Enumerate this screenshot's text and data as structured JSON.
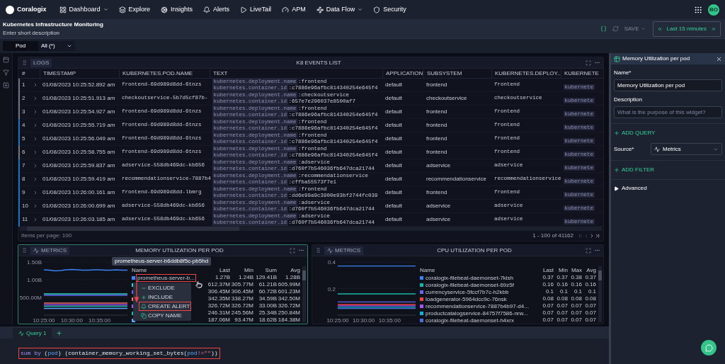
{
  "nav": {
    "brand": "Coralogix",
    "items": [
      {
        "label": "Dashboard",
        "kind": "dashboard",
        "caret": true
      },
      {
        "label": "Explore",
        "kind": "explore",
        "caret": false
      },
      {
        "label": "Insights",
        "kind": "insights",
        "caret": false
      },
      {
        "label": "Alerts",
        "kind": "alerts",
        "caret": false
      },
      {
        "label": "LiveTail",
        "kind": "livetail",
        "caret": false
      },
      {
        "label": "APM",
        "kind": "apm",
        "caret": false
      },
      {
        "label": "Data Flow",
        "kind": "dataflow",
        "caret": true
      },
      {
        "label": "Security",
        "kind": "security",
        "caret": false
      }
    ],
    "avatar": "BO"
  },
  "header": {
    "title": "Kubernetes Infrastructure Monitoring",
    "description": "Enter short description",
    "save": {
      "label": "SAVE",
      "disabled": true
    },
    "time_range": "Last 15 minutes"
  },
  "filter": {
    "label": "Pod",
    "value": "All (*)"
  },
  "logs_widget": {
    "chip": "LOGS",
    "title": "K8 EVENTS LIST",
    "columns": [
      "#",
      "TIMESTAMP",
      "KUBERNETES.POD.NAME",
      "TEXT",
      "APPLICATION",
      "SUBSYSTEM",
      "KUBERNETES.DEPLOY...",
      "KUBERNETE"
    ],
    "rows": [
      {
        "n": "1",
        "timestamp": "01/08/2023 10:25:52.892 am",
        "pod": "frontend-69d989d8dd-6tnzs",
        "text": [
          {
            "kind": "key",
            "text": "kubernetes.deployment.name"
          },
          {
            "kind": "value",
            "text": ":frontend"
          },
          {
            "kind": "key",
            "text": "kubernetes.container.id"
          },
          {
            "kind": "value",
            "text": ":c7886e96afbc814340254e645f4"
          }
        ],
        "application": "default",
        "subsystem": "frontend",
        "deployment": "frontend",
        "column_9": "kubernete",
        "color": "#6b7280"
      },
      {
        "n": "2",
        "timestamp": "01/08/2023 10:25:51.913 am",
        "pod": "checkoutservice-5b7d5cf87b-",
        "text": [
          {
            "kind": "key",
            "text": "kubernetes.deployment.name"
          },
          {
            "kind": "value",
            "text": ":checkoutservice"
          },
          {
            "kind": "key",
            "text": "kubernetes.container.id"
          },
          {
            "kind": "value",
            "text": ":657e7e296037e8500af7"
          }
        ],
        "application": "default",
        "subsystem": "checkoutservice",
        "deployment": "checkoutservice",
        "column_9": "kubernete",
        "color": "#6b7280"
      },
      {
        "n": "3",
        "timestamp": "01/08/2023 10:25:54.927 am",
        "pod": "frontend-69d989d8dd-6tnzs",
        "text": [
          {
            "kind": "key",
            "text": "kubernetes.deployment.name"
          },
          {
            "kind": "value",
            "text": ":frontend"
          },
          {
            "kind": "key",
            "text": "kubernetes.container.id"
          },
          {
            "kind": "value",
            "text": ":c7886e96afbc814340254e645f4"
          }
        ],
        "application": "default",
        "subsystem": "frontend",
        "deployment": "frontend",
        "column_9": "kubernete",
        "color": "#6b7280"
      },
      {
        "n": "4",
        "timestamp": "01/08/2023 10:25:55.719 am",
        "pod": "frontend-69d989d8dd-6tnzs",
        "text": [
          {
            "kind": "key",
            "text": "kubernetes.deployment.name"
          },
          {
            "kind": "value",
            "text": ":frontend"
          },
          {
            "kind": "key",
            "text": "kubernetes.container.id"
          },
          {
            "kind": "value",
            "text": ":c7886e96afbc814340254e645f4"
          }
        ],
        "application": "default",
        "subsystem": "frontend",
        "deployment": "frontend",
        "column_9": "kubernete",
        "color": "#1d6fb8"
      },
      {
        "n": "5",
        "timestamp": "01/08/2023 10:25:56.049 am",
        "pod": "frontend-69d989d8dd-6tnzs",
        "text": [
          {
            "kind": "key",
            "text": "kubernetes.deployment.name"
          },
          {
            "kind": "value",
            "text": ":frontend"
          },
          {
            "kind": "key",
            "text": "kubernetes.container.id"
          },
          {
            "kind": "value",
            "text": ":c7886e96afbc814340254e645f4"
          }
        ],
        "application": "default",
        "subsystem": "frontend",
        "deployment": "frontend",
        "column_9": "kubernete",
        "color": "#1d6fb8"
      },
      {
        "n": "6",
        "timestamp": "01/08/2023 10:25:58.755 am",
        "pod": "frontend-69d989d8dd-6tnzs",
        "text": [
          {
            "kind": "key",
            "text": "kubernetes.deployment.name"
          },
          {
            "kind": "value",
            "text": ":frontend"
          },
          {
            "kind": "key",
            "text": "kubernetes.container.id"
          },
          {
            "kind": "value",
            "text": ":c7886e96afbc814340254e645f4"
          }
        ],
        "application": "default",
        "subsystem": "frontend",
        "deployment": "frontend",
        "column_9": "kubernete",
        "color": "#6b7280"
      },
      {
        "n": "7",
        "timestamp": "01/08/2023 10:25:59.837 am",
        "pod": "adservice-558db469dc-kb656",
        "text": [
          {
            "kind": "key",
            "text": "kubernetes.deployment.name"
          },
          {
            "kind": "value",
            "text": ":adservice"
          },
          {
            "kind": "key",
            "text": "kubernetes.container.id"
          },
          {
            "kind": "value",
            "text": ":d760f7b546036fb647dca21744"
          }
        ],
        "application": "default",
        "subsystem": "adservice",
        "deployment": "adservice",
        "column_9": "kubernete",
        "color": "#1d6fb8"
      },
      {
        "n": "8",
        "timestamp": "01/08/2023 10:25:59.419 am",
        "pod": "recommendationservice-7887b4",
        "text": [
          {
            "kind": "key",
            "text": "kubernetes.deployment.name"
          },
          {
            "kind": "value",
            "text": ":recommendationservice"
          },
          {
            "kind": "key",
            "text": "kubernetes.container.id"
          },
          {
            "kind": "value",
            "text": ":cffba55573f7e1"
          }
        ],
        "application": "default",
        "subsystem": "recommendationservice",
        "deployment": "recommendationservice",
        "column_9": "kubernete",
        "color": "#1d6fb8"
      },
      {
        "n": "9",
        "timestamp": "01/08/2023 10:26:00.161 am",
        "pod": "frontend-69d989d8dd-lbmrg",
        "text": [
          {
            "kind": "key",
            "text": "kubernetes.deployment.name"
          },
          {
            "kind": "value",
            "text": ":frontend"
          },
          {
            "kind": "key",
            "text": "kubernetes.container.id"
          },
          {
            "kind": "value",
            "text": ":dd6e99a9c3900e93bf2744fc039"
          }
        ],
        "application": "default",
        "subsystem": "frontend",
        "deployment": "frontend",
        "column_9": "kubernete",
        "color": "#1d6fb8"
      },
      {
        "n": "10",
        "timestamp": "01/08/2023 10:26:00.699 am",
        "pod": "adservice-558db469dc-kb656",
        "text": [
          {
            "kind": "key",
            "text": "kubernetes.deployment.name"
          },
          {
            "kind": "value",
            "text": ":adservice"
          },
          {
            "kind": "key",
            "text": "kubernetes.container.id"
          },
          {
            "kind": "value",
            "text": ":d760f7b546036fb647dca21744"
          }
        ],
        "application": "default",
        "subsystem": "adservice",
        "deployment": "adservice",
        "column_9": "kubernete",
        "color": "#1d6fb8"
      },
      {
        "n": "11",
        "timestamp": "01/08/2023 10:26:03.185 am",
        "pod": "adservice-558db469dc-kb656",
        "text": [
          {
            "kind": "key",
            "text": "kubernetes.deployment.name"
          },
          {
            "kind": "value",
            "text": ":adservice"
          },
          {
            "kind": "key",
            "text": "kubernetes.container.id"
          },
          {
            "kind": "value",
            "text": ":d760f7b546036fb647dca21744"
          }
        ],
        "application": "default",
        "subsystem": "adservice",
        "deployment": "adservice",
        "column_9": "kubernete",
        "color": "#1d6fb8"
      }
    ],
    "items_per_page": "Items per page: 100",
    "range": "1 - 100 of 41162"
  },
  "metrics_widgets": [
    {
      "chip": "METRICS",
      "title": "MEMORY UTILIZATION PER POD",
      "editing": true,
      "columns": [
        "Name",
        "Last",
        "Min",
        "Sum",
        "Avg"
      ],
      "rows": [
        {
          "name": "prometheus-server-b...",
          "color": "#3b82f6",
          "highlighted": true,
          "values": [
            "1.27B",
            "1.24B",
            "129.41B",
            "1.28B"
          ]
        },
        {
          "color": "#2dd4bf",
          "highlighted": false,
          "values": [
            "612.37M",
            "305.77M",
            "61.21B",
            "605.99M"
          ]
        },
        {
          "color": "#6366f1",
          "highlighted": false,
          "values": [
            "306.45M",
            "306.45M",
            "60.72B",
            "601.23M"
          ]
        },
        {
          "color": "#f87171",
          "highlighted": false,
          "values": [
            "342.35M",
            "338.27M",
            "34.59B",
            "342.50M"
          ]
        },
        {
          "color": "#a855f7",
          "highlighted": false,
          "values": [
            "326.72M",
            "326.72M",
            "33.00B",
            "326.72M"
          ]
        },
        {
          "color": "#14b8a6",
          "highlighted": false,
          "values": [
            "246.31M",
            "245.56M",
            "25.34B",
            "250.84M"
          ]
        },
        {
          "color": "#60a5fa",
          "highlighted": false,
          "values": [
            "187.06M",
            "93.47M",
            "18.62B",
            "184.38M"
          ]
        }
      ],
      "tooltip": "prometheus-server-b6ddb8f5c-pb5hd",
      "context_menu": [
        {
          "label": "EXCLUDE",
          "kind": "exclude",
          "highlighted": false
        },
        {
          "label": "INCLUDE",
          "kind": "include",
          "highlighted": false
        },
        {
          "label": "CREATE ALERT",
          "kind": "alert",
          "highlighted": true
        },
        {
          "label": "COPY NAME",
          "kind": "copy",
          "highlighted": false
        }
      ],
      "chart_data": {
        "type": "line",
        "grid": true,
        "categories": [
          "10:25:00",
          null,
          null,
          null,
          null,
          "10:30:00",
          null,
          null,
          null,
          null,
          "10:35:00",
          null,
          null,
          null,
          null,
          null
        ],
        "ylim": [
          0,
          1500000000
        ],
        "yticks": [
          {
            "value": 500000000,
            "label": "500.00M"
          },
          {
            "value": 1000000000,
            "label": "1.00B"
          },
          {
            "value": 1500000000,
            "label": "1.50B"
          }
        ],
        "series": [
          {
            "color": "#3b82f6",
            "values": [
              1280000000,
              1270000000,
              1250000000,
              1260000000,
              1280000000,
              1290000000,
              1280000000,
              1270000000,
              1270000000,
              1280000000,
              1280000000,
              1270000000,
              1270000000,
              1280000000,
              1270000000,
              1270000000
            ]
          },
          {
            "color": "#2dd4bf",
            "values": [
              600000000,
              600000000,
              600000000,
              600000000,
              600000000,
              600000000,
              600000000,
              600000000,
              600000000,
              600000000,
              600000000,
              600000000,
              600000000,
              600000000,
              600000000,
              600000000
            ]
          },
          {
            "color": "#6366f1",
            "values": [
              560000000,
              560000000,
              560000000,
              560000000,
              560000000,
              560000000,
              560000000,
              560000000,
              560000000,
              560000000,
              560000000,
              560000000,
              560000000,
              560000000,
              560000000,
              560000000
            ]
          },
          {
            "color": "#f87171",
            "values": [
              340000000,
              340000000,
              340000000,
              340000000,
              340000000,
              340000000,
              340000000,
              340000000,
              340000000,
              340000000,
              340000000,
              340000000,
              340000000,
              340000000,
              340000000,
              340000000
            ]
          },
          {
            "color": "#a855f7",
            "values": [
              290000000,
              290000000,
              290000000,
              290000000,
              290000000,
              290000000,
              290000000,
              290000000,
              290000000,
              290000000,
              290000000,
              290000000,
              290000000,
              290000000,
              290000000,
              290000000
            ]
          },
          {
            "color": "#14b8a6",
            "values": [
              250000000,
              250000000,
              250000000,
              250000000,
              250000000,
              250000000,
              250000000,
              250000000,
              250000000,
              250000000,
              250000000,
              250000000,
              250000000,
              250000000,
              250000000,
              250000000
            ]
          },
          {
            "color": "#60a5fa",
            "values": [
              190000000,
              190000000,
              190000000,
              190000000,
              190000000,
              190000000,
              190000000,
              190000000,
              190000000,
              190000000,
              190000000,
              190000000,
              190000000,
              190000000,
              190000000,
              190000000
            ]
          }
        ]
      }
    },
    {
      "chip": "METRICS",
      "title": "CPU UTILIZATION PER POD",
      "editing": false,
      "columns": [
        "Name",
        "Last",
        "Min",
        "Max",
        "Avg"
      ],
      "rows": [
        {
          "name": "coralogix-filebeat-daemonset-7klsh",
          "color": "#3b82f6",
          "highlighted": false,
          "values": [
            "0.37",
            "0.37",
            "0.38",
            "0.37"
          ]
        },
        {
          "name": "coralogix-filebeat-daemonset-69z5f",
          "color": "#14b8a6",
          "highlighted": false,
          "values": [
            "0.16",
            "0.16",
            "0.16",
            "0.16"
          ]
        },
        {
          "name": "currencyservice-5fccf7b7c-h2kbb",
          "color": "#6366f1",
          "highlighted": false,
          "values": [
            "0.1",
            "0.1",
            "0.1",
            "0.1"
          ]
        },
        {
          "name": "loadgenerator-5964dcc9c-76nsk",
          "color": "#ef4444",
          "highlighted": false,
          "values": [
            "0.08",
            "0.08",
            "0.08",
            "0.08"
          ]
        },
        {
          "name": "recommendationservice-7887b4b97-d4...",
          "color": "#a855f7",
          "highlighted": false,
          "values": [
            "0.07",
            "0.07",
            "0.07",
            "0.07"
          ]
        },
        {
          "name": "productcatalogservice-84757f7586-nrw...",
          "color": "#06b6d4",
          "highlighted": false,
          "values": [
            "0.07",
            "0.07",
            "0.07",
            "0.07"
          ]
        },
        {
          "name": "coralogix-filebeat-daemonset-h4xrx",
          "color": "#4f6bd8",
          "highlighted": false,
          "values": [
            "0.07",
            "0.07",
            "0.07",
            "0.07"
          ]
        }
      ],
      "chart_data": {
        "type": "line",
        "grid": true,
        "categories": [
          "10:25:00",
          null,
          null,
          null,
          null,
          "10:30:00",
          null,
          null,
          null,
          null,
          "10:35:00",
          null,
          null,
          null,
          null,
          null
        ],
        "ylim": [
          0,
          0.4
        ],
        "yticks": [
          0.2,
          0.4
        ],
        "series": [
          {
            "color": "#3b82f6",
            "values": [
              0.37,
              0.37,
              0.37,
              0.37,
              0.37,
              0.37,
              0.37,
              0.37,
              0.37,
              0.37,
              0.37,
              0.37,
              0.37,
              0.37,
              0.37,
              0.37
            ]
          },
          {
            "color": "#14b8a6",
            "values": [
              0.16,
              0.16,
              0.16,
              0.16,
              0.16,
              0.16,
              0.16,
              0.16,
              0.16,
              0.16,
              0.16,
              0.16,
              0.16,
              0.16,
              0.16,
              0.16
            ]
          },
          {
            "color": "#6366f1",
            "values": [
              0.1,
              0.1,
              0.1,
              0.1,
              0.1,
              0.1,
              0.1,
              0.1,
              0.1,
              0.1,
              0.1,
              0.1,
              0.1,
              0.1,
              0.1,
              0.1
            ]
          },
          {
            "color": "#ef4444",
            "values": [
              0.08,
              0.08,
              0.08,
              0.08,
              0.08,
              0.08,
              0.08,
              0.08,
              0.08,
              0.08,
              0.08,
              0.08,
              0.08,
              0.08,
              0.08,
              0.08
            ]
          },
          {
            "color": "#a855f7",
            "values": [
              0.07,
              0.07,
              0.07,
              0.07,
              0.07,
              0.07,
              0.07,
              0.07,
              0.07,
              0.07,
              0.07,
              0.07,
              0.07,
              0.07,
              0.07,
              0.07
            ]
          },
          {
            "color": "#06b6d4",
            "values": [
              0.06,
              0.06,
              0.06,
              0.06,
              0.06,
              0.06,
              0.06,
              0.06,
              0.06,
              0.06,
              0.06,
              0.06,
              0.06,
              0.06,
              0.06,
              0.06
            ]
          },
          {
            "color": "#4f6bd8",
            "values": [
              0.05,
              0.05,
              0.05,
              0.05,
              0.05,
              0.05,
              0.05,
              0.05,
              0.05,
              0.05,
              0.05,
              0.05,
              0.05,
              0.05,
              0.05,
              0.05
            ]
          }
        ]
      }
    }
  ],
  "query_editor": {
    "tabs": [
      {
        "label": "Query 1",
        "selected": true
      }
    ],
    "highlighted": true,
    "tokens": [
      {
        "kind": "keyword",
        "text": "sum by"
      },
      {
        "kind": "plain",
        "text": " ("
      },
      {
        "kind": "label",
        "text": "pod"
      },
      {
        "kind": "plain",
        "text": ") (container_memory_working_set_bytes("
      },
      {
        "kind": "label",
        "text": "pod"
      },
      {
        "kind": "operator",
        "text": "!="
      },
      {
        "kind": "string",
        "text": "\"\""
      },
      {
        "kind": "plain",
        "text": "))"
      }
    ]
  },
  "side_panel": {
    "title": "Memory Utilization per pod",
    "name_label": "Name*",
    "name_value": "Memory Utilization per pod",
    "description_label": "Description",
    "description_placeholder": "What is the purpose of this widget?",
    "add_query": "ADD QUERY",
    "source_label": "Source*",
    "source_value": "Metrics",
    "add_filter": "ADD FILTER",
    "advanced": {
      "label": "Advanced",
      "expanded": false
    }
  }
}
